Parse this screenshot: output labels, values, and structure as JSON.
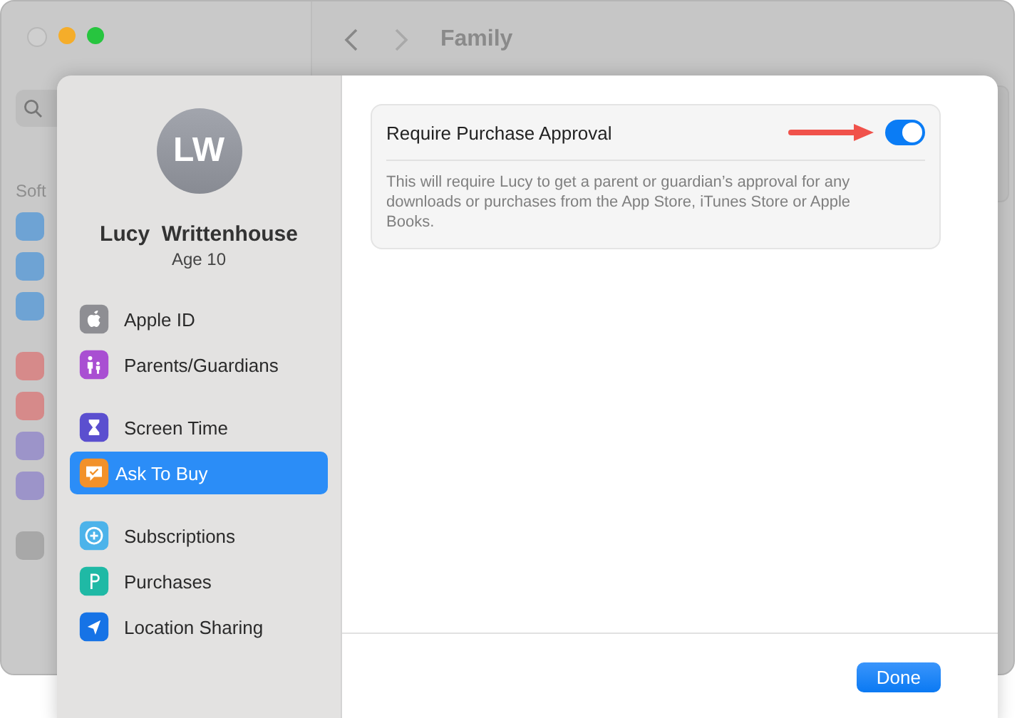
{
  "background_window": {
    "title": "Family",
    "sidebar_section": "Soft"
  },
  "sheet": {
    "avatar": {
      "initials": "LW"
    },
    "name": "Lucy  Writtenhouse",
    "age": "Age 10",
    "menu": [
      [
        {
          "kind": "apple",
          "label": "Apple ID",
          "selected": false
        },
        {
          "kind": "family",
          "label": "Parents/Guardians",
          "selected": false
        }
      ],
      [
        {
          "kind": "hourglass",
          "label": "Screen Time",
          "selected": false
        },
        {
          "kind": "ask",
          "label": "Ask To Buy",
          "selected": true
        }
      ],
      [
        {
          "kind": "subscription",
          "label": "Subscriptions",
          "selected": false
        },
        {
          "kind": "purchase",
          "label": "Purchases",
          "selected": false
        },
        {
          "kind": "location",
          "label": "Location Sharing",
          "selected": false
        }
      ]
    ],
    "setting": {
      "label": "Require Purchase Approval",
      "on": true,
      "description": "This will require Lucy to get a parent or guardian’s approval for any downloads or purchases from the App Store, iTunes Store or Apple Books."
    },
    "buttons": [
      "Done"
    ]
  }
}
